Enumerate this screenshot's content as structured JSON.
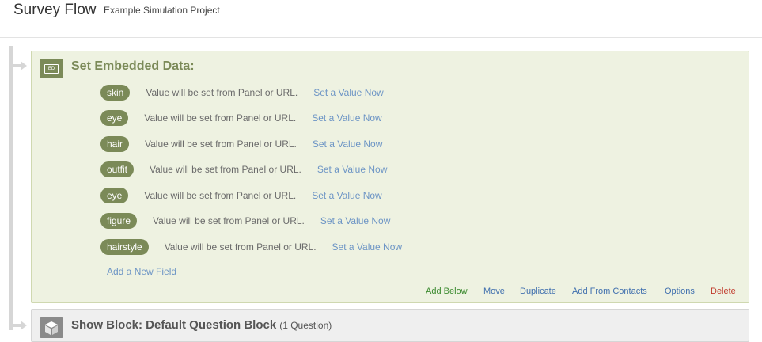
{
  "header": {
    "title": "Survey Flow",
    "project": "Example Simulation Project"
  },
  "embedded_data": {
    "icon": "embedded-data-icon",
    "icon_text": "ED",
    "title": "Set Embedded Data:",
    "fields": [
      {
        "name": "skin",
        "note": "Value will be set from Panel or URL.",
        "link": "Set a Value Now"
      },
      {
        "name": "eye",
        "note": "Value will be set from Panel or URL.",
        "link": "Set a Value Now"
      },
      {
        "name": "hair",
        "note": "Value will be set from Panel or URL.",
        "link": "Set a Value Now"
      },
      {
        "name": "outfit",
        "note": "Value will be set from Panel or URL.",
        "link": "Set a Value Now"
      },
      {
        "name": "eye",
        "note": "Value will be set from Panel or URL.",
        "link": "Set a Value Now"
      },
      {
        "name": "figure",
        "note": "Value will be set from Panel or URL.",
        "link": "Set a Value Now"
      },
      {
        "name": "hairstyle",
        "note": "Value will be set from Panel or URL.",
        "link": "Set a Value Now"
      }
    ],
    "add_field": "Add a New Field",
    "actions": {
      "add_below": "Add Below",
      "move": "Move",
      "duplicate": "Duplicate",
      "add_from_contacts": "Add From Contacts",
      "options": "Options",
      "delete": "Delete"
    }
  },
  "show_block": {
    "icon": "block-cube-icon",
    "title": "Show Block: Default Question Block",
    "count": "(1 Question)"
  },
  "colors": {
    "accent": "#7b8a58",
    "panel_bg": "#eef2e1",
    "link": "#6d95c5",
    "action_green": "#3b8a2f",
    "action_blue": "#3f6fae",
    "action_red": "#c0392b"
  }
}
